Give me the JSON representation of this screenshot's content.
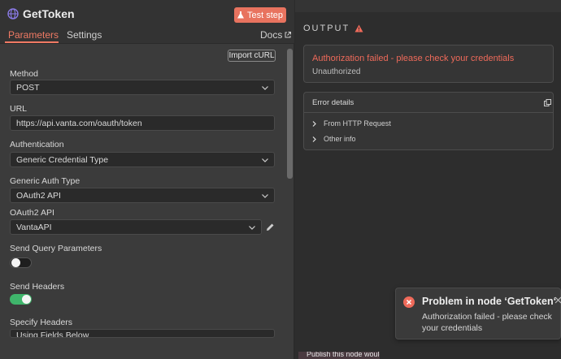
{
  "node": {
    "title": "GetToken",
    "test_button": "Test step",
    "tabs": [
      "Parameters",
      "Settings"
    ],
    "docs_link": "Docs"
  },
  "params": {
    "import_curl": "Import cURL",
    "method_label": "Method",
    "method_value": "POST",
    "url_label": "URL",
    "url_value": "https://api.vanta.com/oauth/token",
    "auth_label": "Authentication",
    "auth_value": "Generic Credential Type",
    "generic_auth_label": "Generic Auth Type",
    "generic_auth_value": "OAuth2 API",
    "oauth2_label": "OAuth2 API",
    "oauth2_value": "VantaAPI",
    "send_query_label": "Send Query Parameters",
    "send_query_on": false,
    "send_headers_label": "Send Headers",
    "send_headers_on": true,
    "specify_headers_label": "Specify Headers",
    "specify_headers_value": "Using Fields Below"
  },
  "output": {
    "title": "OUTPUT",
    "error_title": "Authorization failed - please check your credentials",
    "error_sub": "Unauthorized",
    "details_title": "Error details",
    "details_rows": [
      "From HTTP Request",
      "Other info"
    ]
  },
  "toast": {
    "title": "Problem in node ‘GetToken‘",
    "message": "Authorization failed - please check your credentials"
  },
  "bottom_strip": {
    "text": "Publish this node would"
  },
  "colors": {
    "accent": "#f07a64",
    "error": "#ef6a5a",
    "toggle_on": "#3fb56b"
  }
}
